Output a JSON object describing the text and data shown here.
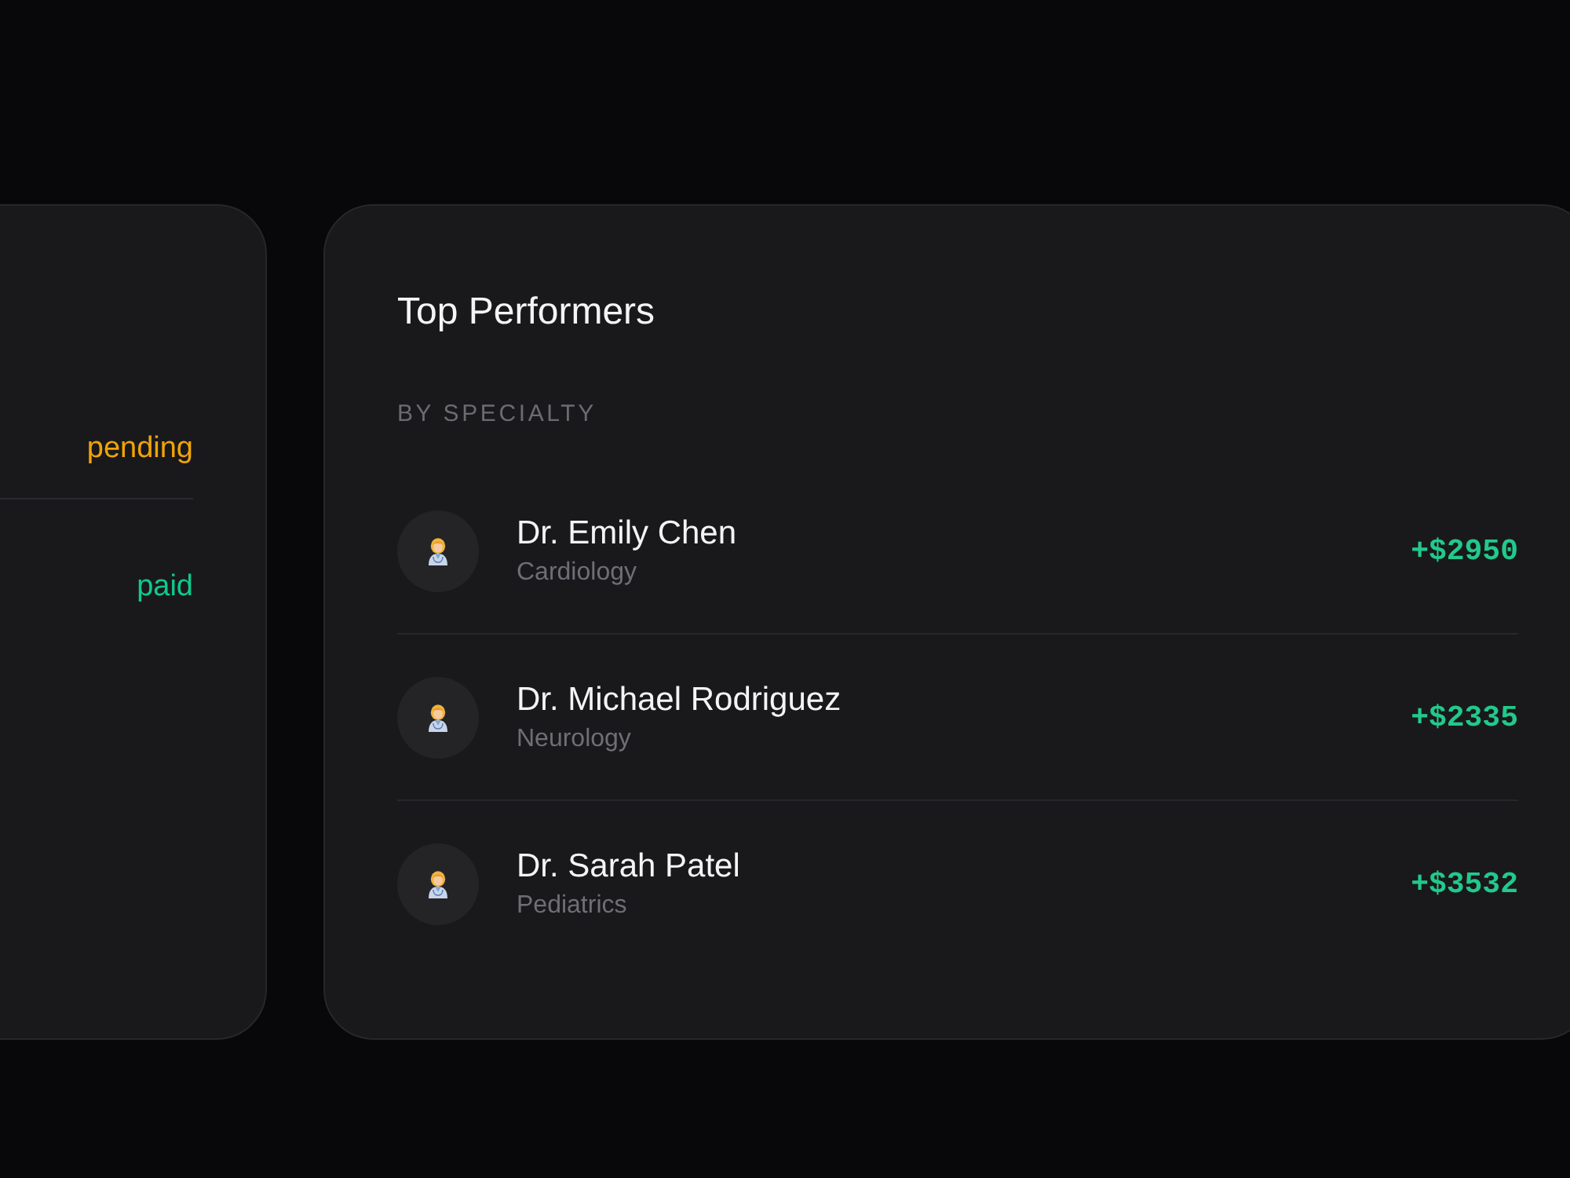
{
  "status_panel": {
    "rows": [
      {
        "status": "pending",
        "color": "#f0a30a"
      },
      {
        "status": "paid",
        "color": "#10c98a"
      }
    ]
  },
  "top_performers": {
    "title": "Top Performers",
    "subtitle": "BY SPECIALTY",
    "doctors": [
      {
        "name": "Dr. Emily Chen",
        "specialty": "Cardiology",
        "amount": "+$2950"
      },
      {
        "name": "Dr. Michael Rodriguez",
        "specialty": "Neurology",
        "amount": "+$2335"
      },
      {
        "name": "Dr. Sarah Patel",
        "specialty": "Pediatrics",
        "amount": "+$3532"
      }
    ]
  }
}
